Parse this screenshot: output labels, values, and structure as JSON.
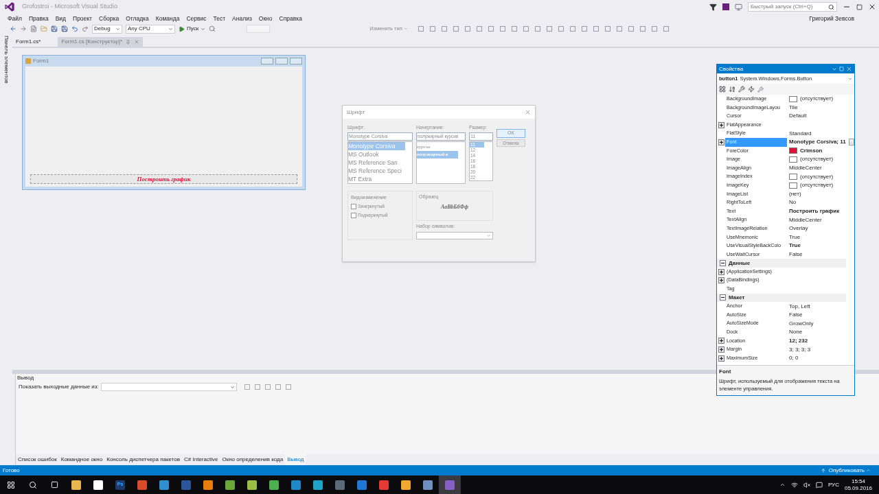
{
  "window": {
    "title": "Grofostroi - Microsoft Visual Studio",
    "quick_launch": {
      "placeholder": "Быстрый запуск (Ctrl+Q)"
    },
    "user": "Григорий Зевсов"
  },
  "menu": [
    "Файл",
    "Правка",
    "Вид",
    "Проект",
    "Сборка",
    "Отладка",
    "Команда",
    "Сервис",
    "Тест",
    "Анализ",
    "Окно",
    "Справка"
  ],
  "toolbar": {
    "configuration": "Debug",
    "platform": "Any CPU",
    "start": "Пуск",
    "change_type": "Изменить тип"
  },
  "side_panel": {
    "label": "Панель элементов"
  },
  "doc_tabs": [
    {
      "label": "Form1.cs*",
      "selected": false
    },
    {
      "label": "Form1.cs [Конструктор]*",
      "selected": true
    }
  ],
  "form": {
    "title": "Form1",
    "button": "Построить график"
  },
  "font_dialog": {
    "title": "Шрифт",
    "font_label": "Шрифт:",
    "font_value": "Monotype Corsiva",
    "style_label": "Начертание:",
    "style_value": "полужирный курсив",
    "size_label": "Размер:",
    "size_value": "11",
    "fonts": [
      {
        "label": "Monotype Corsiva",
        "selected": true
      },
      {
        "label": "MS Outlook",
        "selected": false
      },
      {
        "label": "MS Reference San",
        "selected": false
      },
      {
        "label": "MS Reference Speci",
        "selected": false
      },
      {
        "label": "MT Extra",
        "selected": false
      }
    ],
    "styles": [
      {
        "label": "курсив",
        "selected": false
      },
      {
        "label": "полужирный к",
        "selected": true
      }
    ],
    "sizes": [
      {
        "label": "11",
        "selected": true
      },
      {
        "label": "12",
        "selected": false
      },
      {
        "label": "14",
        "selected": false
      },
      {
        "label": "16",
        "selected": false
      },
      {
        "label": "18",
        "selected": false
      },
      {
        "label": "20",
        "selected": false
      },
      {
        "label": "22",
        "selected": false
      }
    ],
    "ok": "OK",
    "cancel": "Отмена",
    "effects_label": "Видоизменение",
    "effects": [
      {
        "label": "Зачеркнутый",
        "checked": false
      },
      {
        "label": "Подчеркнутый",
        "checked": false
      }
    ],
    "sample_label": "Образец",
    "sample": "АаВbБбФф",
    "charset_label": "Набор символов:"
  },
  "properties": {
    "title": "Свойства",
    "object": "button1",
    "type": "System.Windows.Forms.Button",
    "rows": [
      {
        "kind": "property",
        "name": "BackgroundImage",
        "value": "(отсутствует)",
        "color": "#ffffff"
      },
      {
        "kind": "property",
        "name": "BackgroundImageLayou",
        "value": "Tile"
      },
      {
        "kind": "property",
        "name": "Cursor",
        "value": "Default"
      },
      {
        "kind": "property",
        "name": "FlatAppearance",
        "value": "",
        "expanded": false
      },
      {
        "kind": "property",
        "name": "FlatStyle",
        "value": "Standard"
      },
      {
        "kind": "property",
        "name": "Font",
        "value": "Monotype Corsiva; 11",
        "expanded": false,
        "selected": true,
        "bold": true,
        "button": "…"
      },
      {
        "kind": "property",
        "name": "ForeColor",
        "value": "Crimson",
        "color": "#dc143c",
        "bold": true
      },
      {
        "kind": "property",
        "name": "Image",
        "value": "(отсутствует)",
        "color": "#ffffff"
      },
      {
        "kind": "property",
        "name": "ImageAlign",
        "value": "MiddleCenter"
      },
      {
        "kind": "property",
        "name": "ImageIndex",
        "value": "(отсутствует)",
        "color": "#ffffff"
      },
      {
        "kind": "property",
        "name": "ImageKey",
        "value": "(отсутствует)",
        "color": "#ffffff"
      },
      {
        "kind": "property",
        "name": "ImageList",
        "value": "(нет)"
      },
      {
        "kind": "property",
        "name": "RightToLeft",
        "value": "No"
      },
      {
        "kind": "property",
        "name": "Text",
        "value": "Построить график",
        "bold": true
      },
      {
        "kind": "property",
        "name": "TextAlign",
        "value": "MiddleCenter"
      },
      {
        "kind": "property",
        "name": "TextImageRelation",
        "value": "Overlay"
      },
      {
        "kind": "property",
        "name": "UseMnemonic",
        "value": "True"
      },
      {
        "kind": "property",
        "name": "UseVisualStyleBackColo",
        "value": "True",
        "bold": true
      },
      {
        "kind": "property",
        "name": "UseWaitCursor",
        "value": "False"
      },
      {
        "kind": "category",
        "name": "Данные",
        "expanded": true
      },
      {
        "kind": "property",
        "name": "(ApplicationSettings)",
        "value": "",
        "expanded": false
      },
      {
        "kind": "property",
        "name": "(DataBindings)",
        "value": "",
        "expanded": false
      },
      {
        "kind": "property",
        "name": "Tag",
        "value": ""
      },
      {
        "kind": "category",
        "name": "Макет",
        "expanded": true
      },
      {
        "kind": "property",
        "name": "Anchor",
        "value": "Top, Left"
      },
      {
        "kind": "property",
        "name": "AutoSize",
        "value": "False"
      },
      {
        "kind": "property",
        "name": "AutoSizeMode",
        "value": "GrowOnly"
      },
      {
        "kind": "property",
        "name": "Dock",
        "value": "None"
      },
      {
        "kind": "property",
        "name": "Location",
        "value": "12; 232",
        "expanded": false,
        "bold": true
      },
      {
        "kind": "property",
        "name": "Margin",
        "value": "3; 3; 3; 3",
        "expanded": false
      },
      {
        "kind": "property",
        "name": "MaximumSize",
        "value": "0; 0",
        "expanded": false
      }
    ],
    "help_title": "Font",
    "help_text": "Шрифт, используемый для отображения текста на элементе управления."
  },
  "output": {
    "title": "Вывод",
    "source_label": "Показать выходные данные из:"
  },
  "bottom_tabs": [
    {
      "label": "Список ошибок",
      "selected": false
    },
    {
      "label": "Командное окно",
      "selected": false
    },
    {
      "label": "Консоль диспетчера пакетов",
      "selected": false
    },
    {
      "label": "C# Interactive",
      "selected": false
    },
    {
      "label": "Окно определения кода",
      "selected": false
    },
    {
      "label": "Вывод",
      "selected": true
    }
  ],
  "status_bar": {
    "text": "Готово",
    "publish": "Опубликовать"
  },
  "taskbar": {
    "apps": [
      {
        "color": "#e8b64c",
        "selected": false
      },
      {
        "color": "#ffffff",
        "selected": false
      },
      {
        "color": "#1c3a6e",
        "selected": false,
        "label": "Ps"
      },
      {
        "color": "#d94a2b",
        "selected": false
      },
      {
        "color": "#2f8fd0",
        "selected": false
      },
      {
        "color": "#2b579a",
        "selected": false
      },
      {
        "color": "#e87d0d",
        "selected": false
      },
      {
        "color": "#6aa83c",
        "selected": false
      },
      {
        "color": "#9bbf45",
        "selected": false
      },
      {
        "color": "#4caf50",
        "selected": false
      },
      {
        "color": "#1e88c8",
        "selected": false
      },
      {
        "color": "#1fa3c7",
        "selected": false
      },
      {
        "color": "#5a6a7a",
        "selected": false
      },
      {
        "color": "#1e78d4",
        "selected": false
      },
      {
        "color": "#e53935",
        "selected": false
      },
      {
        "color": "#f0a830",
        "selected": false
      },
      {
        "color": "#7090c0",
        "selected": false
      },
      {
        "color": "#865fc5",
        "selected": true
      }
    ],
    "language": "РУС",
    "time": "15:54",
    "date": "05.09.2016"
  }
}
